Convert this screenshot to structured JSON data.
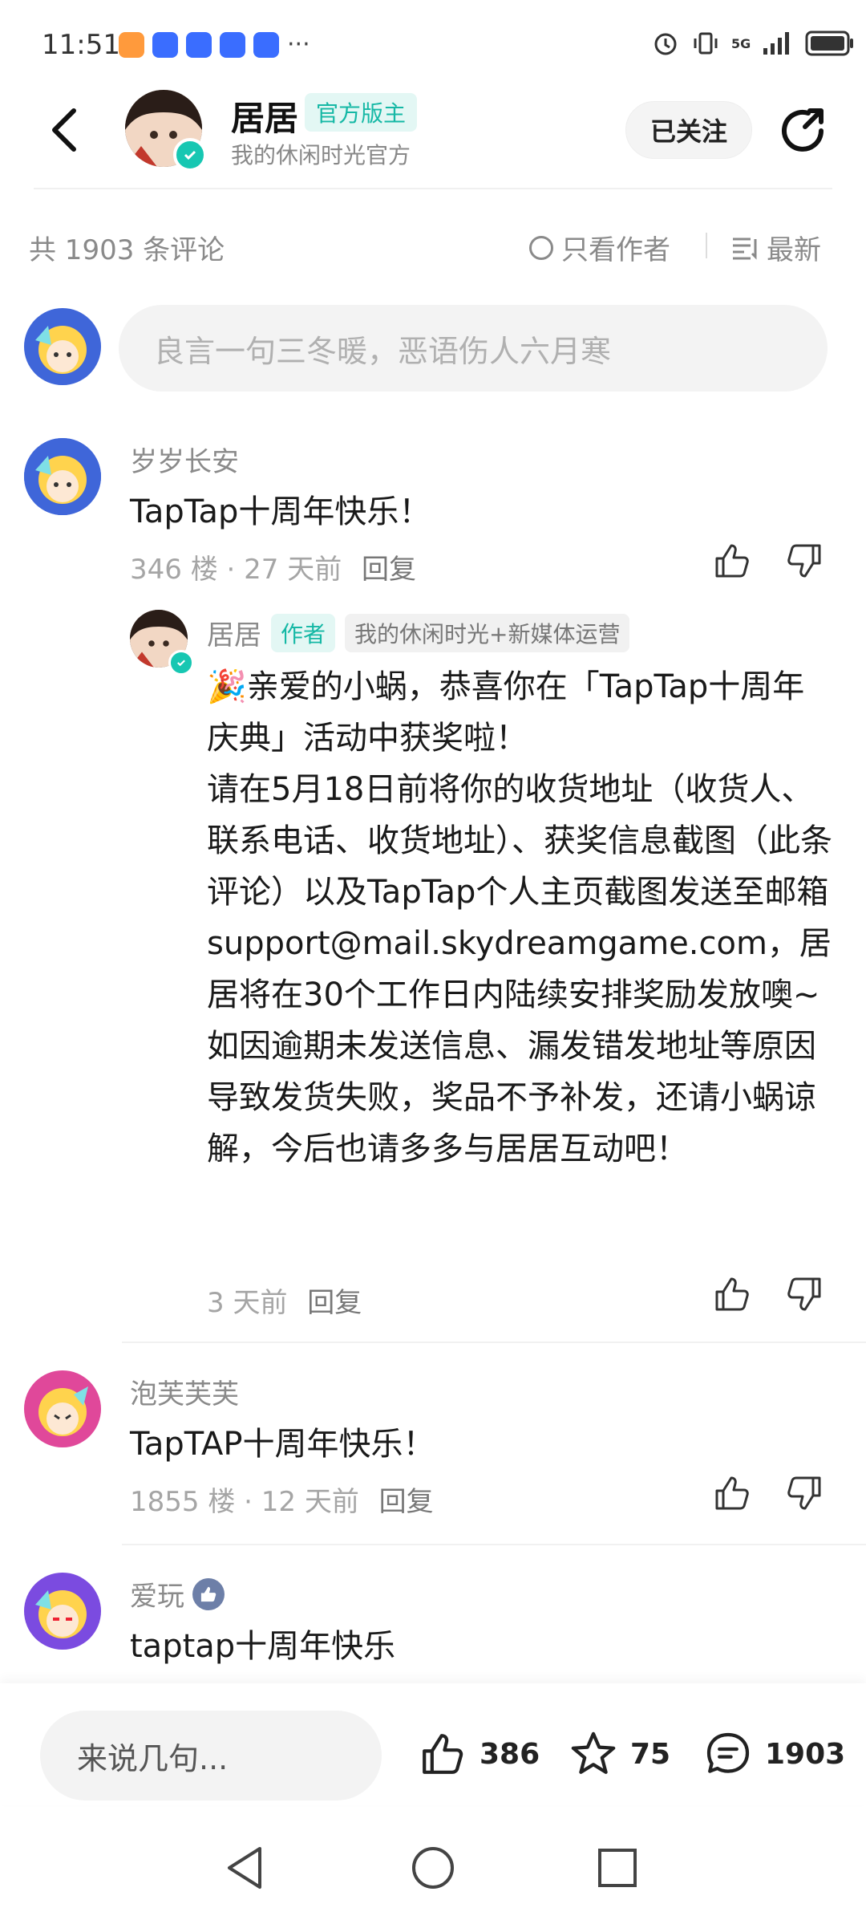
{
  "status_bar": {
    "time": "11:51",
    "more": "···",
    "network": "5G"
  },
  "header": {
    "author_name": "居居",
    "official_badge": "官方版主",
    "author_subtitle": "我的休闲时光官方",
    "follow_label": "已关注"
  },
  "toolbar": {
    "count_label": "共 1903 条评论",
    "only_author_label": "只看作者",
    "sort_label": "最新"
  },
  "input": {
    "placeholder": "良言一句三冬暖，恶语伤人六月寒"
  },
  "comments": [
    {
      "user": "岁岁长安",
      "text": "TapTap十周年快乐！",
      "meta": "346 楼 · 27 天前",
      "reply_label": "回复"
    },
    {
      "user": "泡芙芙芙",
      "text": "TapTAP十周年快乐！",
      "meta": "1855 楼 · 12 天前",
      "reply_label": "回复"
    },
    {
      "user": "爱玩",
      "text": "taptap十周年快乐",
      "meta": "",
      "reply_label": ""
    }
  ],
  "author_reply": {
    "name": "居居",
    "author_tag": "作者",
    "role_tag": "我的休闲时光+新媒体运营",
    "text": "🎉亲爱的小蜗，恭喜你在「TapTap十周年庆典」活动中获奖啦！\n请在5月18日前将你的收货地址（收货人、联系电话、收货地址）、获奖信息截图（此条评论）以及TapTap个人主页截图发送至邮箱\nsupport@mail.skydreamgame.com，居居将在30个工作日内陆续安排奖励发放噢~\n如因逾期未发送信息、漏发错发地址等原因导致发货失败，奖品不予补发，还请小蜗谅解，今后也请多多与居居互动吧！",
    "meta": "3 天前",
    "reply_label": "回复"
  },
  "bottom_bar": {
    "say_placeholder": "来说几句...",
    "likes": "386",
    "favorites": "75",
    "comments": "1903"
  },
  "colors": {
    "accent": "#15b8a5",
    "text_gray": "#8a8a8a"
  }
}
